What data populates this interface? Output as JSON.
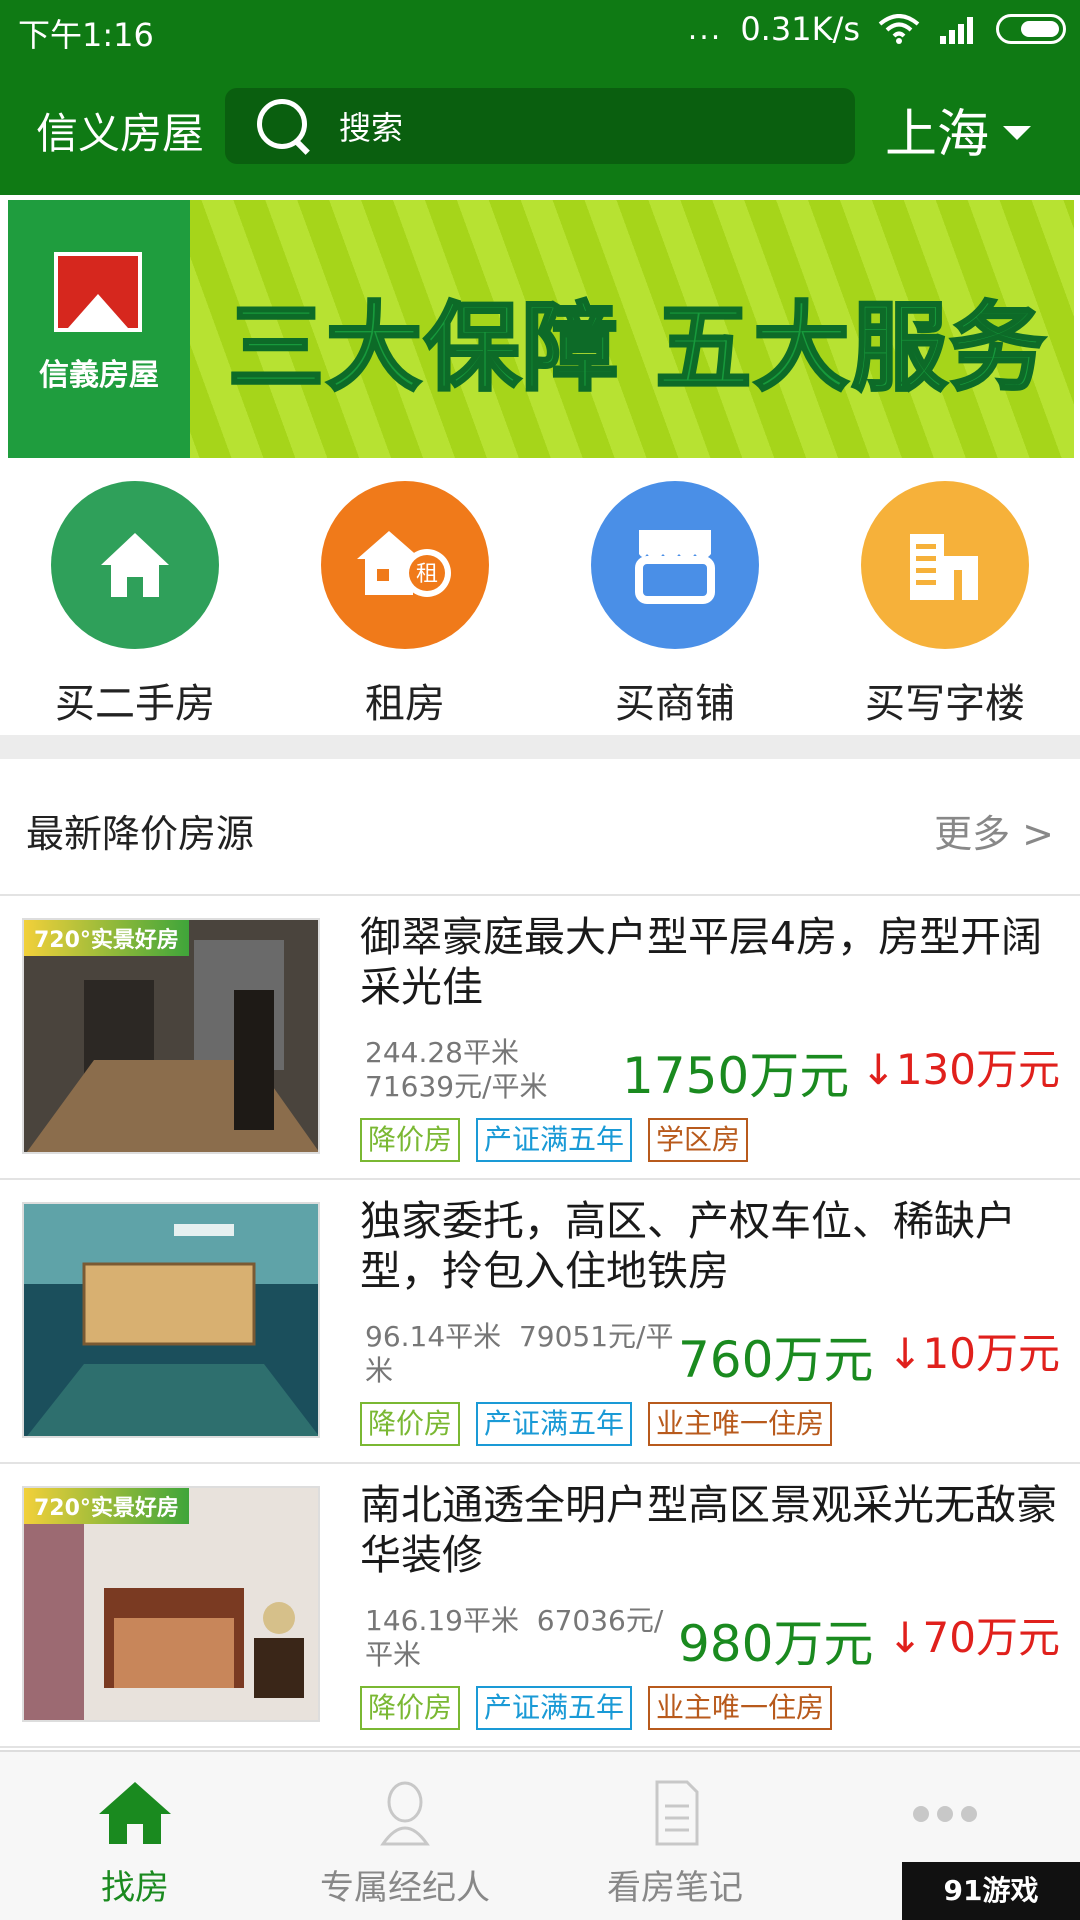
{
  "status_bar": {
    "time": "下午1:16",
    "speed": "0.31K/s",
    "dots": "..."
  },
  "header": {
    "brand": "信义房屋",
    "search_placeholder": "搜索",
    "city": "上海"
  },
  "banner": {
    "logo_text": "信義房屋",
    "slogan": "三大保障 五大服务"
  },
  "categories": [
    {
      "label": "买二手房",
      "icon": "house-icon",
      "color": "#2fa05a"
    },
    {
      "label": "租房",
      "icon": "rent-house-icon",
      "color": "#f07a1a"
    },
    {
      "label": "买商铺",
      "icon": "shop-icon",
      "color": "#4a8fe7"
    },
    {
      "label": "买写字楼",
      "icon": "office-building-icon",
      "color": "#f6b13a"
    }
  ],
  "section": {
    "title": "最新降价房源",
    "more": "更多 >"
  },
  "listings": [
    {
      "title": "御翠豪庭最大户型平层4房，房型开阔采光佳",
      "area": "244.28平米",
      "unit_price": "71639元/平米",
      "price": "1750万元",
      "drop": "↓130万元",
      "badge": "720°实景好房",
      "tags": [
        "降价房",
        "产证满五年",
        "学区房"
      ]
    },
    {
      "title": "独家委托，高区、产权车位、稀缺户型，拎包入住地铁房",
      "area": "96.14平米",
      "unit_price": "79051元/平米",
      "price": "760万元",
      "drop": "↓10万元",
      "badge": "",
      "tags": [
        "降价房",
        "产证满五年",
        "业主唯一住房"
      ]
    },
    {
      "title": "南北通透全明户型高区景观采光无敌豪华装修",
      "area": "146.19平米",
      "unit_price": "67036元/平米",
      "price": "980万元",
      "drop": "↓70万元",
      "badge": "720°实景好房",
      "tags": [
        "降价房",
        "产证满五年",
        "业主唯一住房"
      ]
    }
  ],
  "bottom_nav": [
    {
      "label": "找房",
      "icon": "home-icon",
      "active": true
    },
    {
      "label": "专属经纪人",
      "icon": "person-icon",
      "active": false
    },
    {
      "label": "看房笔记",
      "icon": "note-icon",
      "active": false
    },
    {
      "label": "更多",
      "icon": "more-dots-icon",
      "active": false
    }
  ],
  "watermark": "91游戏"
}
